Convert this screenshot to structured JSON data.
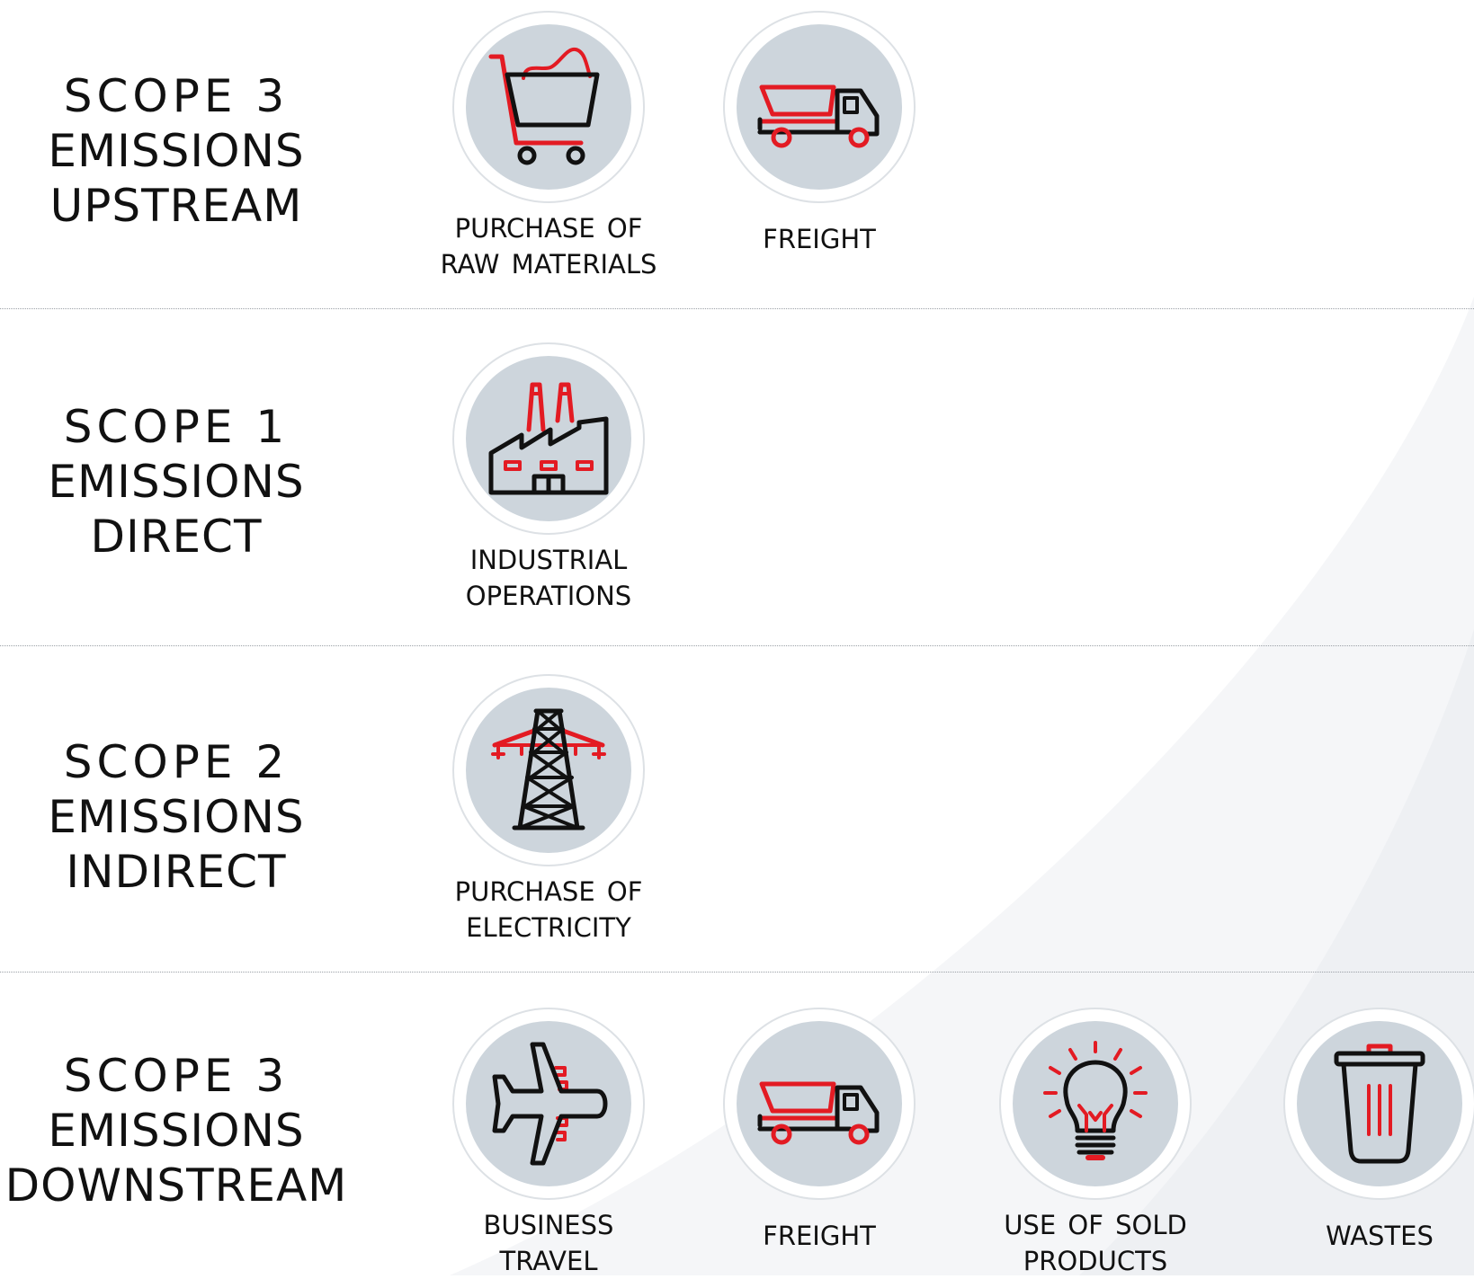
{
  "colors": {
    "accent": "#e31b23",
    "icon_stroke": "#111111",
    "circle_fill": "#cdd5dc",
    "ring": "#dde1e5"
  },
  "rows": [
    {
      "title_lines": [
        "SCOPE 3",
        "EMISSIONS",
        "UPSTREAM"
      ],
      "items": [
        {
          "icon": "shopping-cart-icon",
          "label_lines": [
            "PURCHASE OF",
            "RAW MATERIALS"
          ]
        },
        {
          "icon": "truck-icon",
          "label_lines": [
            "FREIGHT"
          ]
        }
      ]
    },
    {
      "title_lines": [
        "SCOPE 1",
        "EMISSIONS",
        "DIRECT"
      ],
      "items": [
        {
          "icon": "factory-icon",
          "label_lines": [
            "INDUSTRIAL",
            "OPERATIONS"
          ]
        }
      ]
    },
    {
      "title_lines": [
        "SCOPE 2",
        "EMISSIONS",
        "INDIRECT"
      ],
      "items": [
        {
          "icon": "power-tower-icon",
          "label_lines": [
            "PURCHASE OF",
            "ELECTRICITY"
          ]
        }
      ]
    },
    {
      "title_lines": [
        "SCOPE 3",
        "EMISSIONS",
        "DOWNSTREAM"
      ],
      "items": [
        {
          "icon": "airplane-icon",
          "label_lines": [
            "BUSINESS",
            "TRAVEL"
          ]
        },
        {
          "icon": "truck-icon",
          "label_lines": [
            "FREIGHT"
          ]
        },
        {
          "icon": "light-bulb-icon",
          "label_lines": [
            "USE OF SOLD",
            "PRODUCTS"
          ]
        },
        {
          "icon": "trash-bin-icon",
          "label_lines": [
            "WASTES"
          ]
        }
      ]
    }
  ]
}
